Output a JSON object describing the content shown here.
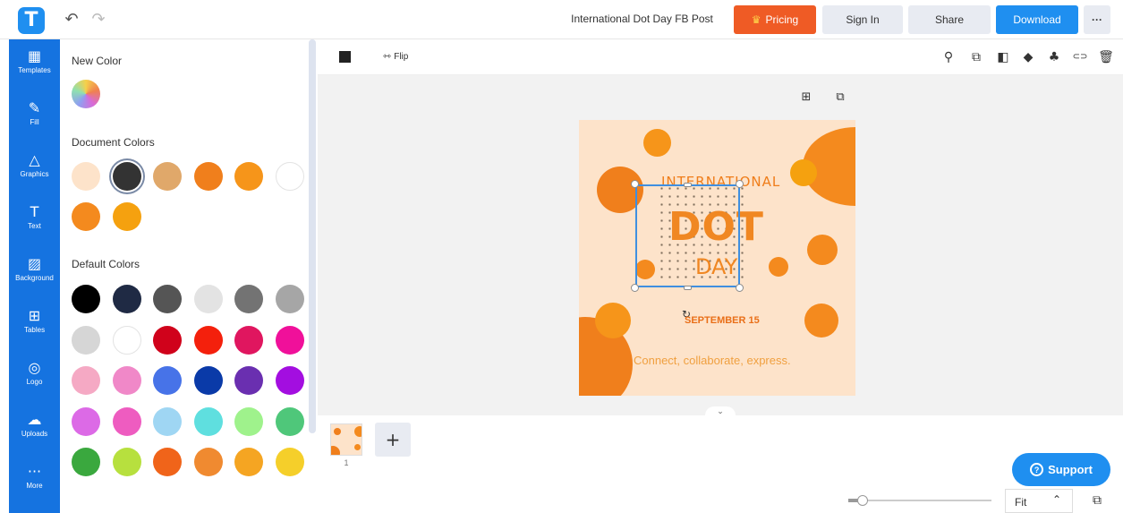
{
  "header": {
    "logo_letter": "T",
    "undo_glyph": "↶",
    "redo_glyph": "↷",
    "doc_title": "International Dot Day FB Post",
    "pricing_label": "Pricing",
    "pricing_icon": "♛",
    "signin_label": "Sign In",
    "share_label": "Share",
    "download_label": "Download",
    "more_label": "···"
  },
  "nav": [
    {
      "label": "Templates",
      "icon": "▦"
    },
    {
      "label": "Fill",
      "icon": "✎"
    },
    {
      "label": "Graphics",
      "icon": "△"
    },
    {
      "label": "Text",
      "icon": "T"
    },
    {
      "label": "Background",
      "icon": "▨"
    },
    {
      "label": "Tables",
      "icon": "⊞"
    },
    {
      "label": "Logo",
      "icon": "◎"
    },
    {
      "label": "Uploads",
      "icon": "☁"
    },
    {
      "label": "More",
      "icon": "···"
    }
  ],
  "panel": {
    "new_color_title": "New Color",
    "document_colors_title": "Document Colors",
    "default_colors_title": "Default Colors",
    "document_colors": [
      "#fde3ca",
      "#333333",
      "#e0a86a",
      "#f07f1c",
      "#f6951a",
      "#ffffff",
      "#f48a1e",
      "#f5a10f"
    ],
    "default_colors": [
      "#000000",
      "#1f2a44",
      "#555555",
      "#e3e3e3",
      "#737373",
      "#a6a6a6",
      "#d6d6d6",
      "#ffffff",
      "#d0021b",
      "#f4200c",
      "#e0165f",
      "#f0109a",
      "#f5a9c4",
      "#f088c8",
      "#4773e8",
      "#0a3aa8",
      "#6a2fb0",
      "#a30ee0",
      "#dc6ae6",
      "#ee5cc0",
      "#9fd6f3",
      "#5fdfdf",
      "#9ff28c",
      "#4fc77a",
      "#3aa83e",
      "#b7e03e",
      "#f0641a",
      "#f08a30",
      "#f5a522",
      "#f5cf2a"
    ]
  },
  "toolbar": {
    "flip_label": "Flip",
    "flip_icon": "⇿",
    "icons": [
      "⚲",
      "⧉",
      "◧",
      "◆",
      "♣",
      "⊂⊃",
      "🗑"
    ]
  },
  "page_icons": {
    "add": "⊞",
    "copy": "⧉"
  },
  "design": {
    "line1": "INTERNATIONAL",
    "line2": "DOT",
    "line3": "DAY",
    "date": "SEPTEMBER 15",
    "tagline": "Connect, collaborate, express.",
    "rotate_icon": "↻",
    "colors": {
      "bg": "#fde3ca",
      "accent": "#f6951a"
    }
  },
  "pages": {
    "thumb_number": "1",
    "add_label": "+",
    "collapse_glyph": "⌄"
  },
  "footer": {
    "support_label": "Support",
    "zoom_label": "Fit",
    "zoom_chevron": "⌃",
    "pages_icon": "⧉"
  }
}
